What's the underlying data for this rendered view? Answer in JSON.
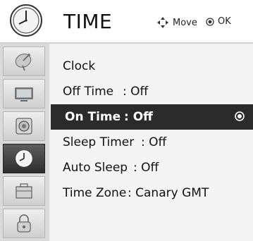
{
  "header": {
    "title": "TIME",
    "hint_move": "Move",
    "hint_ok": "OK",
    "icon": "clock-icon"
  },
  "sidebar": {
    "items": [
      {
        "icon": "satellite-dish-icon",
        "active": false
      },
      {
        "icon": "monitor-icon",
        "active": false
      },
      {
        "icon": "speaker-icon",
        "active": false
      },
      {
        "icon": "clock-icon",
        "active": true
      },
      {
        "icon": "toolbox-icon",
        "active": false
      },
      {
        "icon": "lock-icon",
        "active": false
      }
    ]
  },
  "menu": {
    "items": [
      {
        "label": "Clock",
        "value": ""
      },
      {
        "label": "Off Time",
        "value": ": Off"
      },
      {
        "label": "On Time",
        "value": ": Off",
        "selected": true
      },
      {
        "label": "Sleep Timer",
        "value": ": Off"
      },
      {
        "label": "Auto Sleep",
        "value": ": Off"
      },
      {
        "label": "Time Zone",
        "value": ": Canary GMT"
      }
    ]
  }
}
